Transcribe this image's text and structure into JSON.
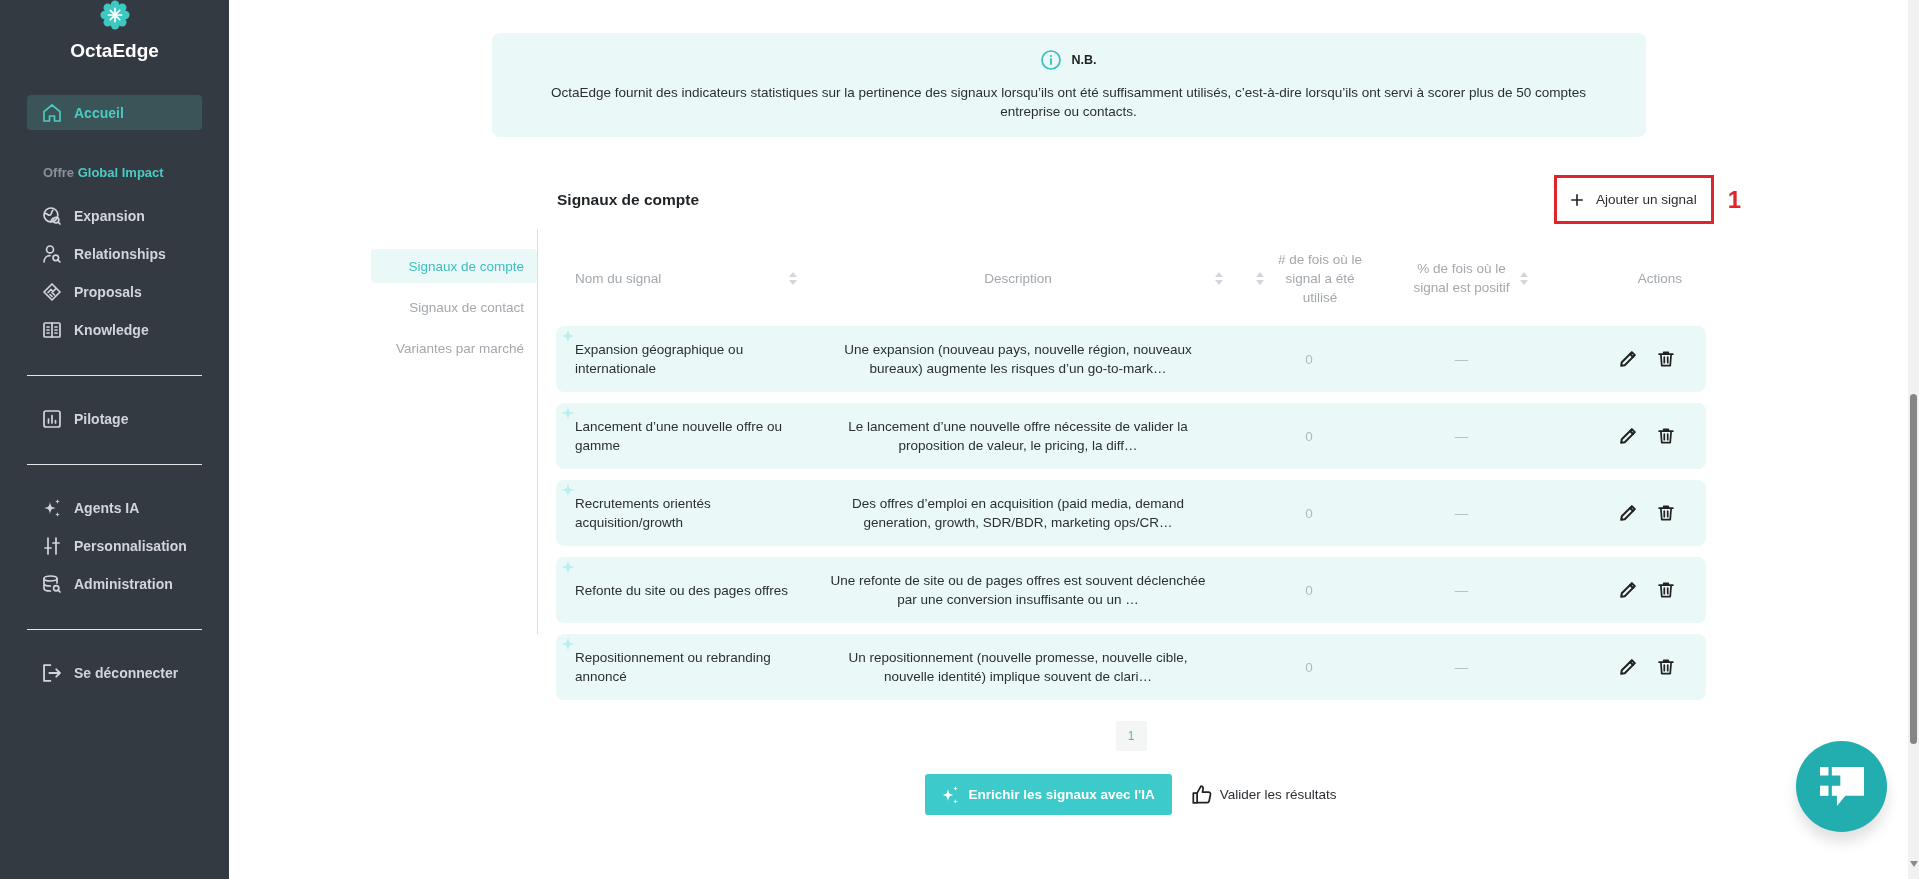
{
  "sidebar": {
    "brand": "OctaEdge",
    "home": {
      "label": "Accueil",
      "selected": true
    },
    "groups": [
      {
        "heading": {
          "label": "Offre",
          "highlight": "Global Impact"
        },
        "items": [
          {
            "label": "Expansion",
            "selected": false
          },
          {
            "label": "Relationships",
            "selected": false
          },
          {
            "label": "Proposals",
            "selected": false
          },
          {
            "label": "Knowledge",
            "selected": false
          }
        ]
      },
      {
        "items": [
          {
            "label": "Pilotage",
            "selected": false
          }
        ]
      },
      {
        "items": [
          {
            "label": "Agents IA",
            "selected": false
          },
          {
            "label": "Personnalisation",
            "selected": false
          },
          {
            "label": "Administration",
            "selected": false
          }
        ]
      },
      {
        "items": [
          {
            "label": "Se déconnecter",
            "selected": false
          }
        ]
      }
    ]
  },
  "notice": {
    "title": "N.B.",
    "text": "OctaEdge fournit des indicateurs statistiques sur la pertinence des signaux lorsqu’ils ont été suffisamment utilisés, c’est-à-dire lorsqu’ils ont servi à scorer plus de 50 comptes entreprise ou contacts."
  },
  "section": {
    "title": "Signaux de compte",
    "add_button": {
      "label": "Ajouter un signal",
      "annotation": "1"
    }
  },
  "subnav": [
    {
      "label": "Signaux de compte",
      "selected": true
    },
    {
      "label": "Signaux de contact",
      "selected": false
    },
    {
      "label": "Variantes par marché",
      "selected": false
    }
  ],
  "table": {
    "columns": [
      {
        "label": "Nom du signal",
        "sortable": true
      },
      {
        "label": "Description",
        "sortable": true
      },
      {
        "label": "# de fois où le signal a été utilisé",
        "sortable": true
      },
      {
        "label": "% de fois où le signal est positif",
        "sortable": true
      },
      {
        "label": "Actions",
        "sortable": false
      }
    ],
    "rows": [
      {
        "name": "Expansion géographique ou internationale",
        "description": "Une expansion (nouveau pays, nouvelle région, nouveaux bureaux) augmente les risques d’un go-to-mark…",
        "uses": "0",
        "positive_rate": "—"
      },
      {
        "name": "Lancement d’une nouvelle offre ou gamme",
        "description": "Le lancement d’une nouvelle offre nécessite de valider la proposition de valeur, le pricing, la diff…",
        "uses": "0",
        "positive_rate": "—"
      },
      {
        "name": "Recrutements orientés acquisition/growth",
        "description": "Des offres d’emploi en acquisition (paid media, demand generation, growth, SDR/BDR, marketing ops/CR…",
        "uses": "0",
        "positive_rate": "—"
      },
      {
        "name": "Refonte du site ou des pages offres",
        "description": "Une refonte de site ou de pages offres est souvent déclenchée par une conversion insuffisante ou un …",
        "uses": "0",
        "positive_rate": "—"
      },
      {
        "name": "Repositionnement ou rebranding annoncé",
        "description": "Un repositionnement (nouvelle promesse, nouvelle cible, nouvelle identité) implique souvent de clari…",
        "uses": "0",
        "positive_rate": "—"
      }
    ]
  },
  "pagination": [
    {
      "label": "1",
      "selected": true
    }
  ],
  "actions": {
    "enrich_button": {
      "label": "Enrichir les signaux avec l'IA"
    },
    "validate_button": {
      "label": "Valider les résultats"
    }
  }
}
